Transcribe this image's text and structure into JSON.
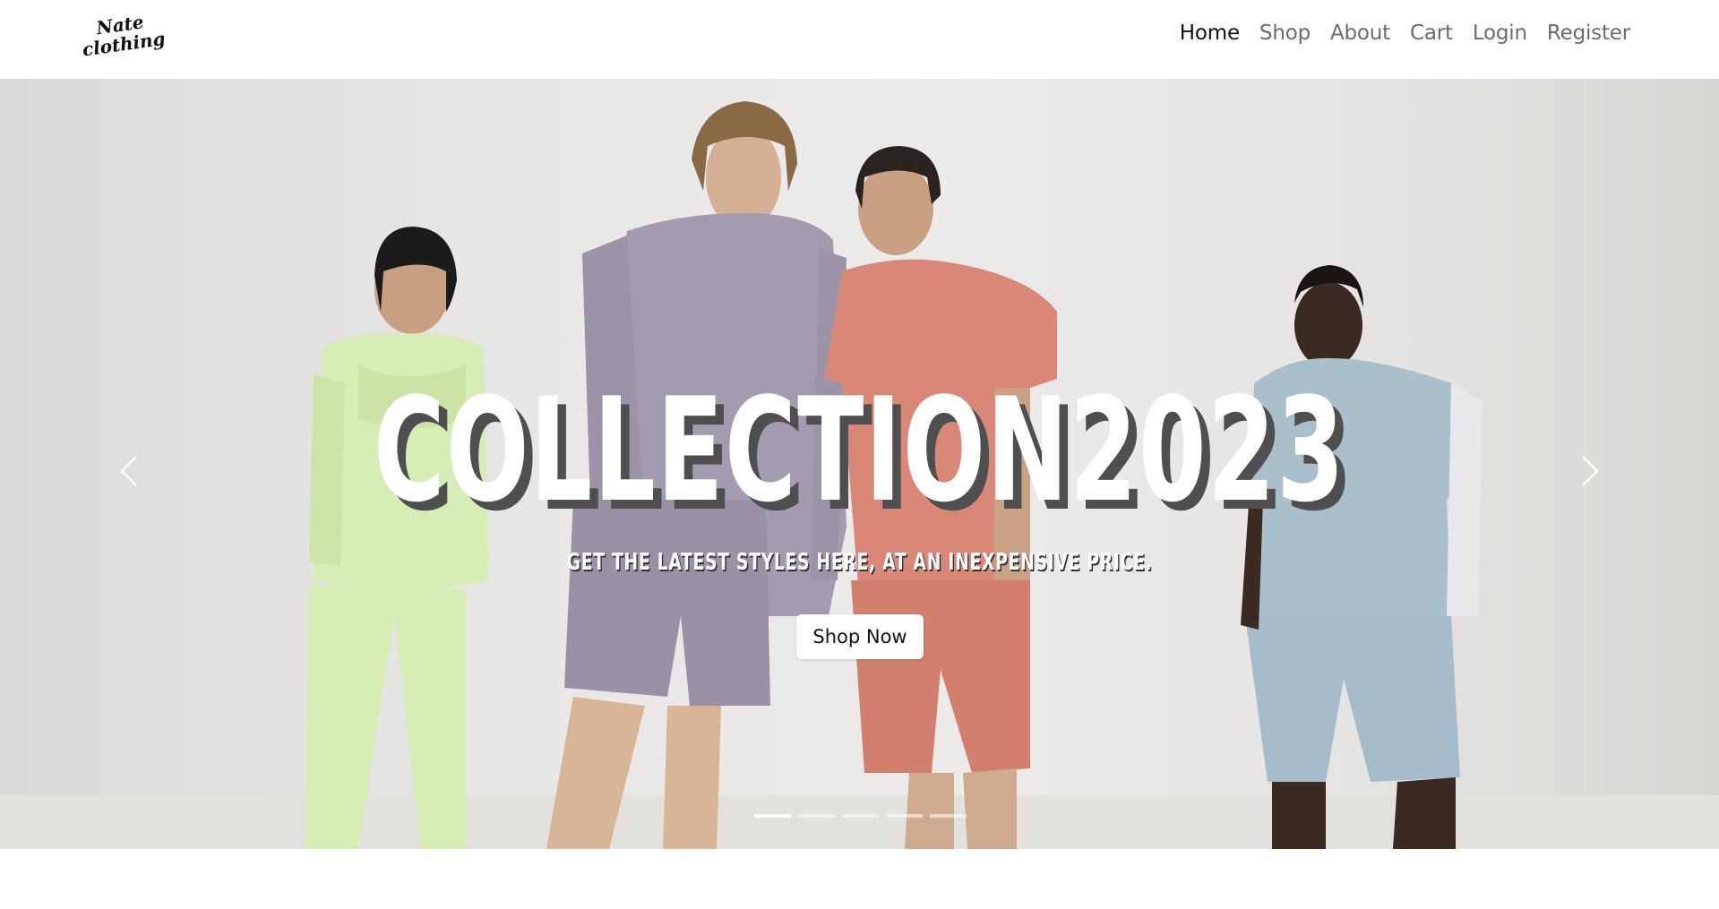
{
  "brand": {
    "logo_line1": "Nate",
    "logo_line2": "clothing",
    "logo_icon": "script-logo"
  },
  "nav": {
    "items": [
      {
        "label": "Home",
        "active": true
      },
      {
        "label": "Shop",
        "active": false
      },
      {
        "label": "About",
        "active": false
      },
      {
        "label": "Cart",
        "active": false
      },
      {
        "label": "Login",
        "active": false
      },
      {
        "label": "Register",
        "active": false
      }
    ]
  },
  "hero": {
    "title": "COLLECTION2023",
    "subtitle": "GET THE LATEST STYLES HERE, AT AN INEXPENSIVE PRICE.",
    "cta_label": "Shop Now",
    "prev_icon": "chevron-left-icon",
    "next_icon": "chevron-right-icon",
    "slide_count": 5,
    "active_slide": 1
  },
  "colors": {
    "nav_active": "#111111",
    "nav_inactive": "#6b6b6b",
    "hoodie_green": "#d6edb5",
    "sweat_lavender": "#a49bb0",
    "tee_coral": "#d98877",
    "hoodie_blue": "#a9bfcc"
  }
}
